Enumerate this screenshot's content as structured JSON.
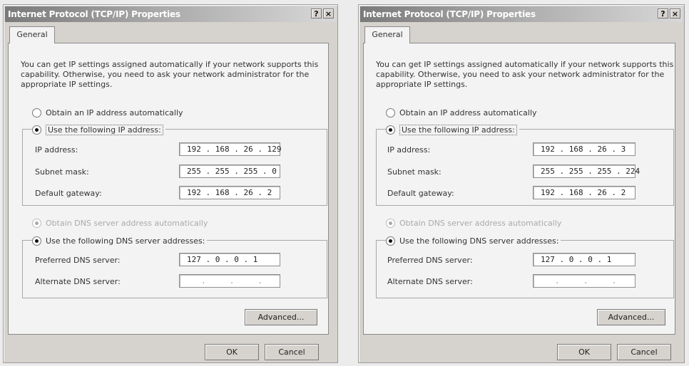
{
  "dialogs": [
    {
      "title": "Internet Protocol (TCP/IP) Properties",
      "help_button": "?",
      "close_button": "×",
      "tab_label": "General",
      "intro_text": "You can get IP settings assigned automatically if your network supports this capability. Otherwise, you need to ask your network administrator for the appropriate IP settings.",
      "radio_obtain_ip": "Obtain an IP address automatically",
      "radio_use_ip": "Use the following IP address:",
      "ip_label": "IP address:",
      "ip_value": "192 . 168 . 26 . 129",
      "subnet_label": "Subnet mask:",
      "subnet_value": "255 . 255 . 255 . 0",
      "gateway_label": "Default gateway:",
      "gateway_value": "192 . 168 . 26 . 2",
      "radio_obtain_dns": "Obtain DNS server address automatically",
      "radio_use_dns": "Use the following DNS server addresses:",
      "preferred_dns_label": "Preferred DNS server:",
      "preferred_dns_value": "127 . 0 . 0 . 1",
      "alternate_dns_label": "Alternate DNS server:",
      "alternate_dns_value": ".     .     .",
      "advanced_button": "Advanced...",
      "ok_button": "OK",
      "cancel_button": "Cancel"
    },
    {
      "title": "Internet Protocol (TCP/IP) Properties",
      "help_button": "?",
      "close_button": "×",
      "tab_label": "General",
      "intro_text": "You can get IP settings assigned automatically if your network supports this capability. Otherwise, you need to ask your network administrator for the appropriate IP settings.",
      "radio_obtain_ip": "Obtain an IP address automatically",
      "radio_use_ip": "Use the following IP address:",
      "ip_label": "IP address:",
      "ip_value": "192 . 168 . 26 . 3",
      "subnet_label": "Subnet mask:",
      "subnet_value": "255 . 255 . 255 . 224",
      "gateway_label": "Default gateway:",
      "gateway_value": "192 . 168 . 26 . 2",
      "radio_obtain_dns": "Obtain DNS server address automatically",
      "radio_use_dns": "Use the following DNS server addresses:",
      "preferred_dns_label": "Preferred DNS server:",
      "preferred_dns_value": "127 . 0 . 0 . 1",
      "alternate_dns_label": "Alternate DNS server:",
      "alternate_dns_value": ".     .     .",
      "advanced_button": "Advanced...",
      "ok_button": "OK",
      "cancel_button": "Cancel"
    }
  ]
}
